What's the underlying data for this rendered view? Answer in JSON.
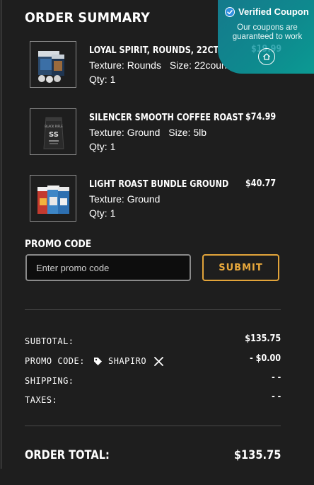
{
  "summary": {
    "title": "ORDER SUMMARY"
  },
  "items": [
    {
      "name": "LOYAL SPIRIT, ROUNDS, 22CT",
      "texture_label": "Texture:",
      "texture": "Rounds",
      "size_label": "Size:",
      "size": "22count",
      "qty_label": "Qty:",
      "qty": "1",
      "price": "$19.99"
    },
    {
      "name": "SILENCER SMOOTH COFFEE ROAST",
      "texture_label": "Texture:",
      "texture": "Ground",
      "size_label": "Size:",
      "size": "5lb",
      "qty_label": "Qty:",
      "qty": "1",
      "price": "$74.99"
    },
    {
      "name": "LIGHT ROAST BUNDLE GROUND",
      "texture_label": "Texture:",
      "texture": "Ground",
      "qty_label": "Qty:",
      "qty": "1",
      "price": "$40.77"
    }
  ],
  "promo": {
    "label": "PROMO CODE",
    "placeholder": "Enter promo code",
    "value": "",
    "submit_label": "SUBMIT"
  },
  "totals": {
    "subtotal_label": "SUBTOTAL:",
    "subtotal": "$135.75",
    "promo_label": "PROMO CODE:",
    "promo_code": "SHAPIRO",
    "promo_discount": "- $0.00",
    "shipping_label": "SHIPPING:",
    "shipping": "- -",
    "taxes_label": "TAXES:",
    "taxes": "- -",
    "total_label": "ORDER TOTAL:",
    "total": "$135.75"
  },
  "coupon_badge": {
    "title": "Verified Coupon",
    "line1": "Our coupons are",
    "line2": "guaranteed to work"
  },
  "icons": {
    "tag": "tag-icon",
    "remove": "close-icon",
    "verified": "check-circle-icon",
    "home": "home-icon"
  },
  "colors": {
    "background": "#1e1e1e",
    "accent": "#e9a93c",
    "badge": "#0e8a8e",
    "text": "#ffffff"
  }
}
